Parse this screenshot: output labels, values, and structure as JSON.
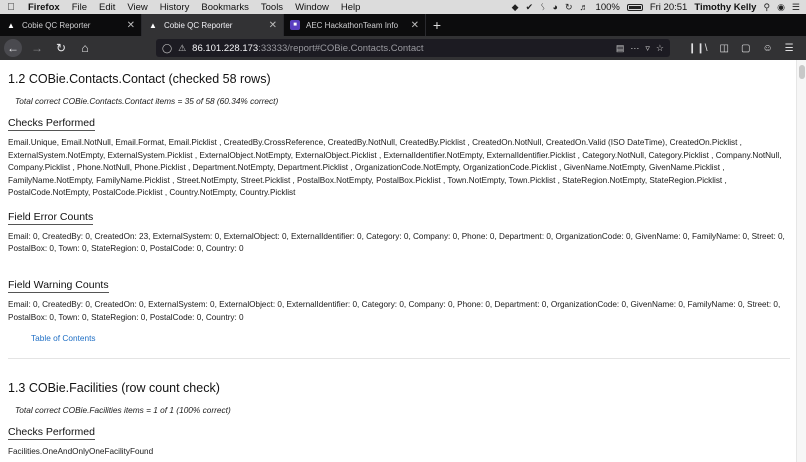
{
  "menubar": {
    "apple": "",
    "app": "Firefox",
    "items": [
      "File",
      "Edit",
      "View",
      "History",
      "Bookmarks",
      "Tools",
      "Window",
      "Help"
    ],
    "battery": "100%",
    "clock": "Fri 20:51",
    "user": "Timothy Kelly"
  },
  "tabs": [
    {
      "label": "Cobie QC Reporter",
      "active": false,
      "icon": "firefox-mark"
    },
    {
      "label": "Cobie QC Reporter",
      "active": true,
      "icon": "firefox-mark"
    },
    {
      "label": "AEC HackathonTeam Info",
      "active": false,
      "icon": "team-badge"
    }
  ],
  "navbar": {
    "url_host": "86.101.228.173",
    "url_rest": ":33333/report#COBie.Contacts.Contact"
  },
  "sections": {
    "contacts": {
      "title": "1.2 COBie.Contacts.Contact  (checked 58 rows)",
      "summary": "Total correct COBie.Contacts.Contact items  = 35 of 58 (60.34% correct)",
      "checks_heading": "Checks Performed",
      "checks_text": "Email.Unique, Email.NotNull, Email.Format, Email.Picklist , CreatedBy.CrossReference, CreatedBy.NotNull, CreatedBy.Picklist , CreatedOn.NotNull, CreatedOn.Valid (ISO DateTime), CreatedOn.Picklist , ExternalSystem.NotEmpty, ExternalSystem.Picklist , ExternalObject.NotEmpty, ExternalObject.Picklist , ExternalIdentifier.NotEmpty, ExternalIdentifier.Picklist , Category.NotNull, Category.Picklist , Company.NotNull, Company.Picklist , Phone.NotNull, Phone.Picklist , Department.NotEmpty, Department.Picklist , OrganizationCode.NotEmpty, OrganizationCode.Picklist , GivenName.NotEmpty, GivenName.Picklist , FamilyName.NotEmpty, FamilyName.Picklist , Street.NotEmpty, Street.Picklist , PostalBox.NotEmpty, PostalBox.Picklist , Town.NotEmpty, Town.Picklist , StateRegion.NotEmpty, StateRegion.Picklist , PostalCode.NotEmpty, PostalCode.Picklist , Country.NotEmpty, Country.Picklist",
      "errors_heading": "Field Error Counts",
      "errors_text": "Email: 0, CreatedBy: 0, CreatedOn: 23, ExternalSystem: 0, ExternalObject: 0, ExternalIdentifier: 0, Category: 0, Company: 0, Phone: 0, Department: 0, OrganizationCode: 0, GivenName: 0, FamilyName: 0, Street: 0, PostalBox: 0, Town: 0, StateRegion: 0, PostalCode: 0, Country: 0",
      "warnings_heading": "Field Warning Counts",
      "warnings_text": "Email: 0, CreatedBy: 0, CreatedOn: 0, ExternalSystem: 0, ExternalObject: 0, ExternalIdentifier: 0, Category: 0, Company: 0, Phone: 0, Department: 0, OrganizationCode: 0, GivenName: 0, FamilyName: 0, Street: 0, PostalBox: 0, Town: 0, StateRegion: 0, PostalCode: 0, Country: 0",
      "toc_link": "Table of Contents"
    },
    "facilities": {
      "title": "1.3 COBie.Facilities  (row count check)",
      "summary": "Total correct COBie.Facilities items  = 1 of 1 (100% correct)",
      "checks_heading": "Checks Performed",
      "checks_text": "Facilities.OneAndOnlyOneFacilityFound"
    }
  },
  "colors": {
    "link": "#1f6fc5",
    "tabbar_bg": "#0c0c0d",
    "toolbar_bg": "#323234"
  }
}
